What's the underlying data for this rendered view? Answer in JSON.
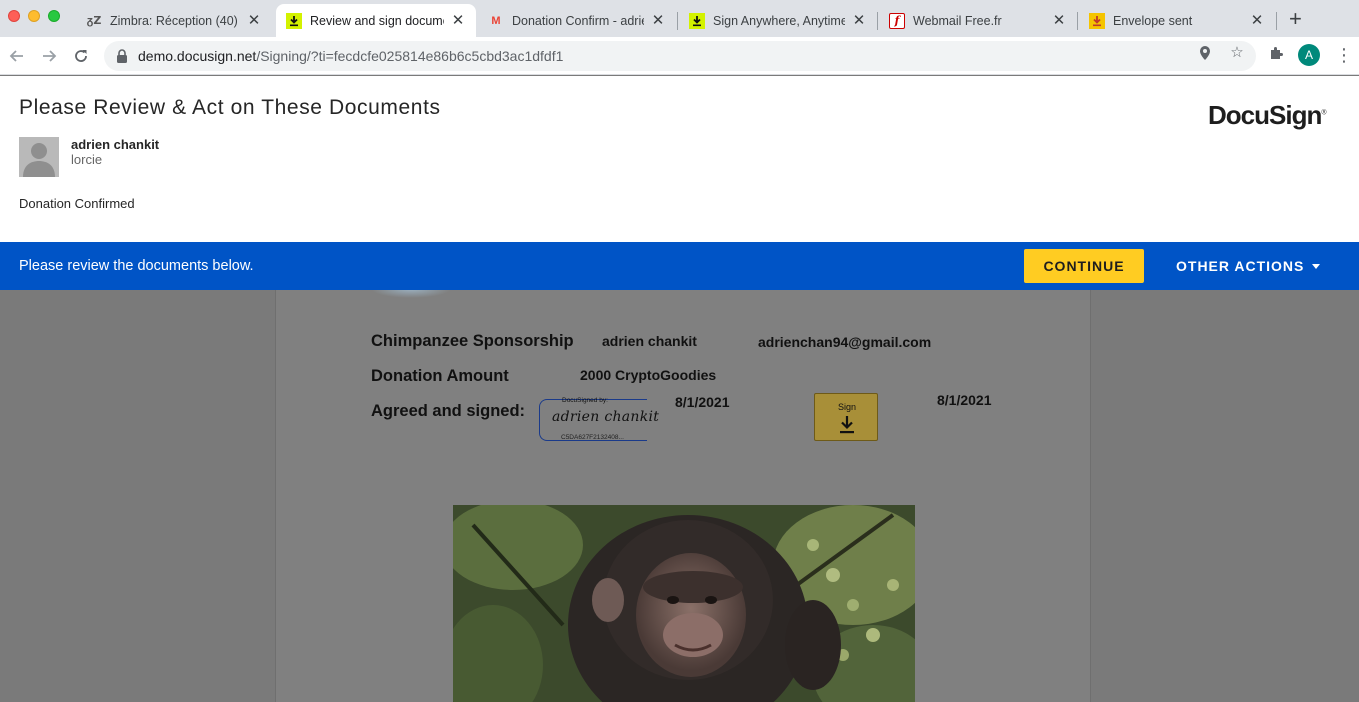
{
  "browser": {
    "tabs": [
      {
        "title": "Zimbra: Réception (40)",
        "favicon": "zimbra-icon"
      },
      {
        "title": "Review and sign document(s)",
        "favicon": "docusign-download-icon",
        "active": true
      },
      {
        "title": "Donation Confirm - adrien",
        "favicon": "gmail-icon"
      },
      {
        "title": "Sign Anywhere, Anytime",
        "favicon": "docusign-download-icon"
      },
      {
        "title": "Webmail Free.fr",
        "favicon": "free-icon"
      },
      {
        "title": "Envelope sent",
        "favicon": "envelope-download-icon"
      }
    ],
    "url_host": "demo.docusign.net",
    "url_path": "/Signing/?ti=fecdcfe025814e86b6c5cbd3ac1dfdf1",
    "profile_initial": "A"
  },
  "header": {
    "title": "Please Review & Act on These Documents",
    "logo": "DocuSign",
    "sender_name": "adrien chankit",
    "sender_org": "lorcie",
    "subject": "Donation Confirmed"
  },
  "action_bar": {
    "message": "Please review the documents below.",
    "continue_label": "CONTINUE",
    "other_actions_label": "OTHER ACTIONS"
  },
  "document": {
    "row1_label": "Chimpanzee Sponsorship",
    "row1_name": "adrien chankit",
    "row1_email": "adrienchan94@gmail.com",
    "row2_label": "Donation Amount",
    "row2_value": "2000 CryptoGoodies",
    "row3_label": "Agreed and signed:",
    "signature_header": "DocuSigned by:",
    "signature_text": "adrien chankit",
    "signature_hash": "C5DA627F2132408...",
    "date_1": "8/1/2021",
    "sign_tag_label": "Sign",
    "date_2": "8/1/2021"
  },
  "colors": {
    "action_bar": "#0054c6",
    "continue_button": "#ffcc22",
    "sign_tag": "#a88f38"
  }
}
